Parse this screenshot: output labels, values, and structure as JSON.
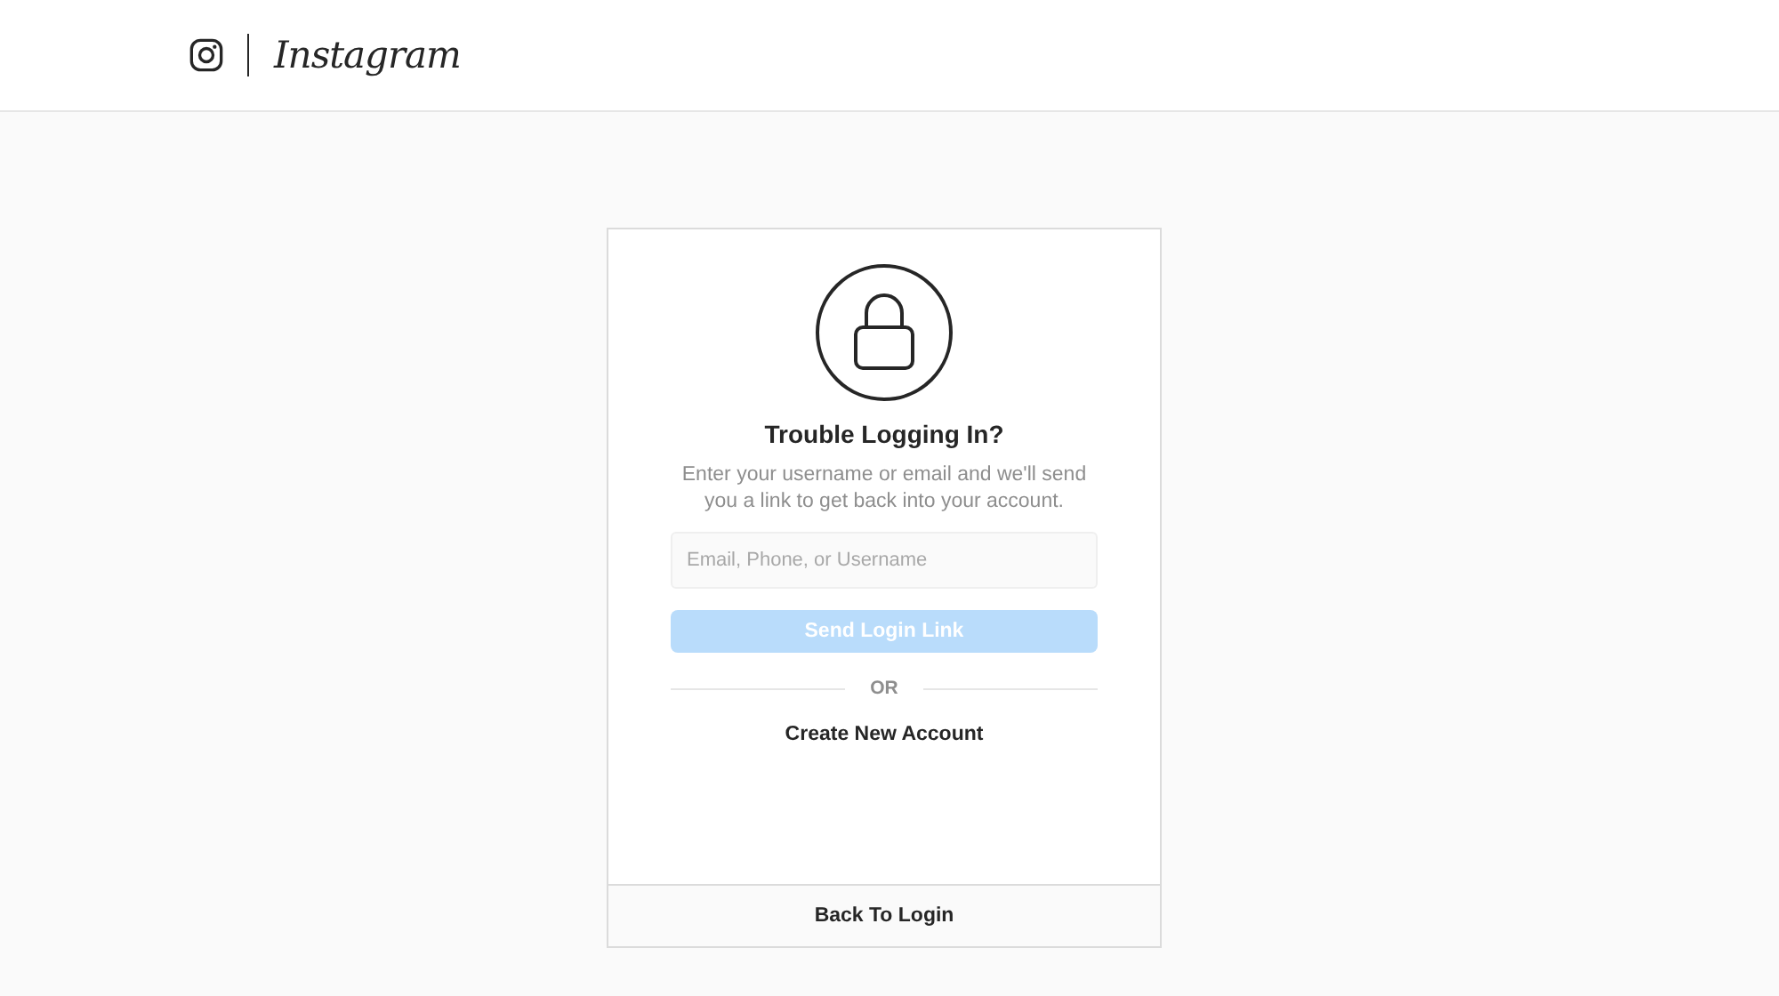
{
  "header": {
    "logo_text": "Instagram"
  },
  "card": {
    "title": "Trouble Logging In?",
    "description": "Enter your username or email and we'll send you a link to get back into your account.",
    "input": {
      "placeholder": "Email, Phone, or Username"
    },
    "submit": {
      "label": "Send Login Link",
      "disabled": true
    },
    "divider_text": "OR",
    "create_link": "Create New Account",
    "footer_link": "Back To Login"
  }
}
